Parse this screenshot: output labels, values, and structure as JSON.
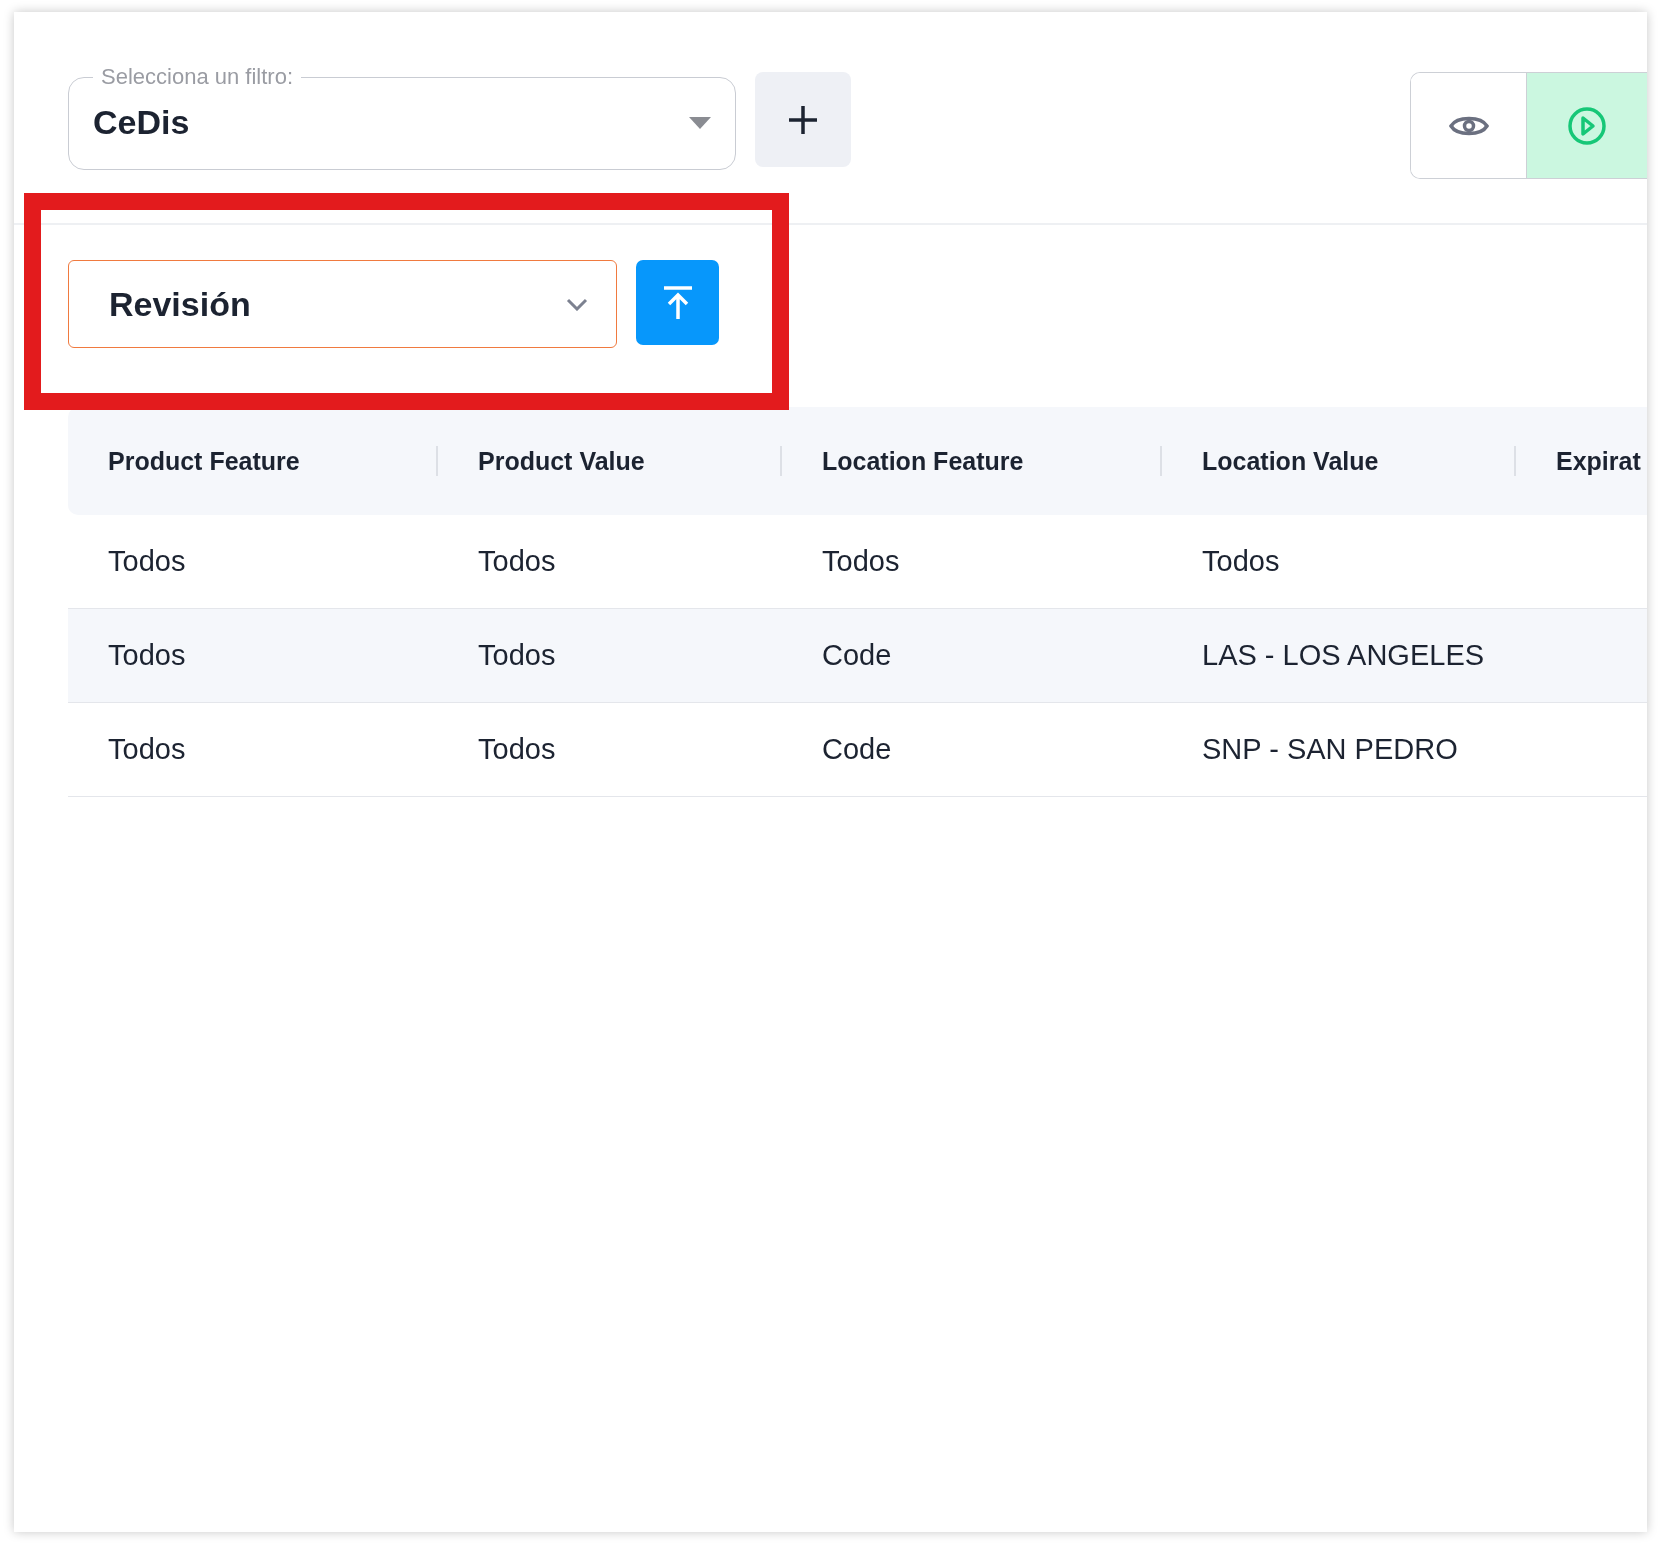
{
  "filter": {
    "label": "Selecciona un filtro:",
    "value": "CeDis"
  },
  "status_select": {
    "value": "Revisión"
  },
  "table": {
    "columns": [
      "Product Feature",
      "Product Value",
      "Location Feature",
      "Location Value",
      "Expirat"
    ],
    "rows": [
      [
        "Todos",
        "Todos",
        "Todos",
        "Todos"
      ],
      [
        "Todos",
        "Todos",
        "Code",
        "LAS - LOS ANGELES"
      ],
      [
        "Todos",
        "Todos",
        "Code",
        "SNP - SAN PEDRO"
      ]
    ]
  }
}
